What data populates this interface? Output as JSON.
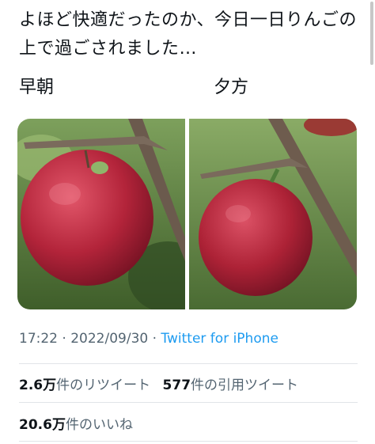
{
  "tweet": {
    "text": "よほど快適だったのか、今日一日りんごの上で過ごされました…",
    "captions": {
      "left": "早朝",
      "right": "夕方"
    }
  },
  "media": {
    "images": [
      {
        "subject": "apple-with-frog-morning"
      },
      {
        "subject": "apple-with-frog-evening"
      }
    ]
  },
  "meta": {
    "time": "17:22",
    "sep1": " · ",
    "date": "2022/09/30",
    "sep2": " · ",
    "source": "Twitter for iPhone"
  },
  "stats": {
    "retweets_count": "2.6万",
    "retweets_label": "件のリツイート",
    "quotes_count": "577",
    "quotes_label": "件の引用ツイート",
    "likes_count": "20.6万",
    "likes_label": "件のいいね"
  },
  "colors": {
    "link": "#1d9bf0",
    "secondary": "#536471",
    "apple": "#b3243a",
    "leaf": "#4f7d3a"
  }
}
